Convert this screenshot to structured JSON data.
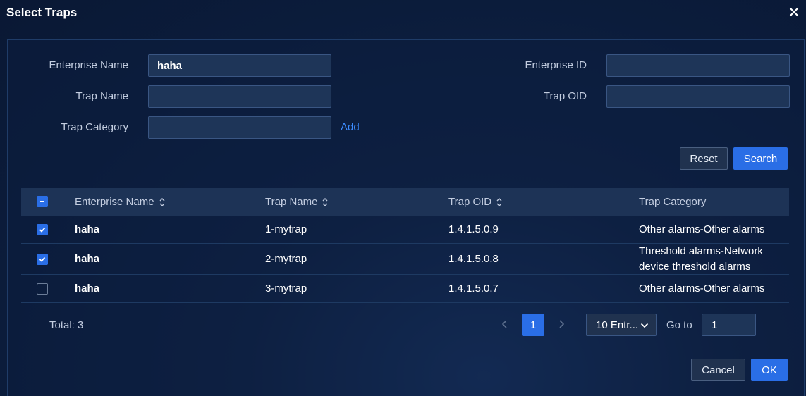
{
  "dialog": {
    "title": "Select Traps"
  },
  "filters": {
    "enterprise_name": {
      "label": "Enterprise Name",
      "value": "haha",
      "placeholder": ""
    },
    "enterprise_id": {
      "label": "Enterprise ID",
      "value": "",
      "placeholder": ""
    },
    "trap_name": {
      "label": "Trap Name",
      "value": "",
      "placeholder": ""
    },
    "trap_oid": {
      "label": "Trap OID",
      "value": "",
      "placeholder": ""
    },
    "trap_category": {
      "label": "Trap Category",
      "value": "",
      "placeholder": ""
    },
    "add_label": "Add",
    "reset_label": "Reset",
    "search_label": "Search"
  },
  "table": {
    "columns": [
      {
        "label": "Enterprise Name",
        "sortable": true
      },
      {
        "label": "Trap Name",
        "sortable": true
      },
      {
        "label": "Trap OID",
        "sortable": true
      },
      {
        "label": "Trap Category",
        "sortable": false
      }
    ],
    "header_checkbox": "indeterminate",
    "rows": [
      {
        "checked": true,
        "enterprise_name": "haha",
        "trap_name": "1-mytrap",
        "trap_oid": "1.4.1.5.0.9",
        "category": "Other alarms-Other alarms"
      },
      {
        "checked": true,
        "enterprise_name": "haha",
        "trap_name": "2-mytrap",
        "trap_oid": "1.4.1.5.0.8",
        "category": "Threshold alarms-Network device threshold alarms"
      },
      {
        "checked": false,
        "enterprise_name": "haha",
        "trap_name": "3-mytrap",
        "trap_oid": "1.4.1.5.0.7",
        "category": "Other alarms-Other alarms"
      }
    ]
  },
  "pagination": {
    "total_label": "Total: 3",
    "current_page": "1",
    "page_size": "10 Entr...",
    "goto_label": "Go to",
    "goto_value": "1"
  },
  "footer": {
    "cancel_label": "Cancel",
    "ok_label": "OK"
  },
  "colors": {
    "accent": "#2a6ee6",
    "link": "#3d8cff",
    "background": "#0b1c3b"
  }
}
